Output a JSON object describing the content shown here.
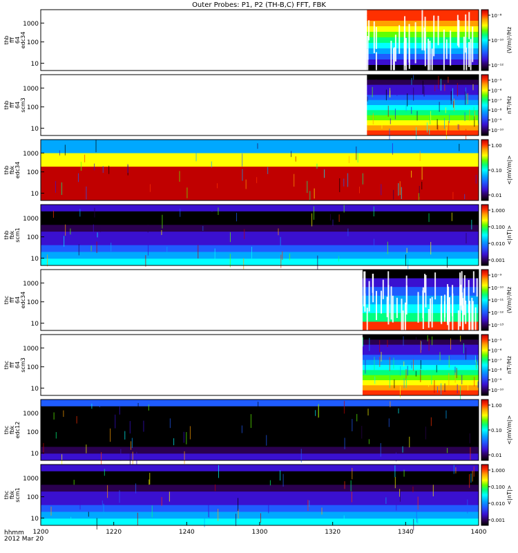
{
  "title": "Outer Probes: P1, P2 (TH-B,C) FFT, FBK",
  "x_axis": {
    "ticks": [
      "1200",
      "1220",
      "1240",
      "1300",
      "1320",
      "1340",
      "1400"
    ],
    "label_line1": "hhmm",
    "label_line2": "2012 Mar 20"
  },
  "colors": {
    "background": "#ffffff",
    "frame": "#000000",
    "colormap": [
      "#000000",
      "#2a0050",
      "#3a10d0",
      "#1f5cff",
      "#00a8ff",
      "#00ffff",
      "#00ff80",
      "#60ff00",
      "#ffff00",
      "#ffa000",
      "#ff3000",
      "#c00000"
    ]
  },
  "chart_data": [
    {
      "type": "heatmap",
      "ylabel": [
        "thb",
        "fff",
        "64",
        "edc34"
      ],
      "yticks": [
        "1000",
        "100",
        "10"
      ],
      "zlabel": "(V/m)²/Hz",
      "zticks": [
        "10⁻⁸",
        "10⁻¹⁰",
        "10⁻¹²"
      ],
      "data_start_frac": 0.745,
      "pattern": "bursty"
    },
    {
      "type": "heatmap",
      "ylabel": [
        "thb",
        "fff",
        "64",
        "scm3"
      ],
      "yticks": [
        "1000",
        "100",
        "10"
      ],
      "zlabel": "nT²/Hz",
      "zticks": [
        "10⁻⁵",
        "10⁻⁶",
        "10⁻⁷",
        "10⁻⁸",
        "10⁻⁹",
        "10⁻¹⁰"
      ],
      "data_start_frac": 0.745,
      "pattern": "scm"
    },
    {
      "type": "heatmap",
      "ylabel": [
        "thb",
        "fbk",
        "edc34"
      ],
      "yticks": [
        "1000",
        "100",
        "10"
      ],
      "zlabel": "<|mV/m|>",
      "zticks": [
        "1.00",
        "0.10",
        "0.01"
      ],
      "data_start_frac": 0.0,
      "pattern": "edc_fbk"
    },
    {
      "type": "heatmap",
      "ylabel": [
        "thb",
        "fbk",
        "scm1"
      ],
      "yticks": [
        "1000",
        "100",
        "10"
      ],
      "zlabel": "<|nT|>",
      "zticks": [
        "1.000",
        "0.100",
        "0.010",
        "0.001"
      ],
      "data_start_frac": 0.0,
      "pattern": "scm_fbk"
    },
    {
      "type": "heatmap",
      "ylabel": [
        "thc",
        "fff",
        "64",
        "edc34"
      ],
      "yticks": [
        "1000",
        "100",
        "10"
      ],
      "zlabel": "(V/m)²/Hz",
      "zticks": [
        "10⁻⁹",
        "10⁻¹⁰",
        "10⁻¹¹",
        "10⁻¹²",
        "10⁻¹³"
      ],
      "data_start_frac": 0.735,
      "pattern": "sparse"
    },
    {
      "type": "heatmap",
      "ylabel": [
        "thc",
        "fff",
        "64",
        "scm3"
      ],
      "yticks": [
        "1000",
        "100",
        "10"
      ],
      "zlabel": "nT²/Hz",
      "zticks": [
        "10⁻⁵",
        "10⁻⁶",
        "10⁻⁷",
        "10⁻⁸",
        "10⁻⁹",
        "10⁻¹⁰"
      ],
      "data_start_frac": 0.735,
      "pattern": "scm"
    },
    {
      "type": "heatmap",
      "ylabel": [
        "thc",
        "fbk",
        "edc12"
      ],
      "yticks": [
        "1000",
        "100",
        "10"
      ],
      "zlabel": "<|mV/m|>",
      "zticks": [
        "1.00",
        "0.10",
        "0.01"
      ],
      "data_start_frac": 0.0,
      "pattern": "dark_fbk"
    },
    {
      "type": "heatmap",
      "ylabel": [
        "thc",
        "fbk",
        "scm1"
      ],
      "yticks": [
        "1000",
        "100",
        "10"
      ],
      "zlabel": "<|nT|>",
      "zticks": [
        "1.000",
        "0.100",
        "0.010",
        "0.001"
      ],
      "data_start_frac": 0.0,
      "pattern": "scm_fbk"
    }
  ]
}
